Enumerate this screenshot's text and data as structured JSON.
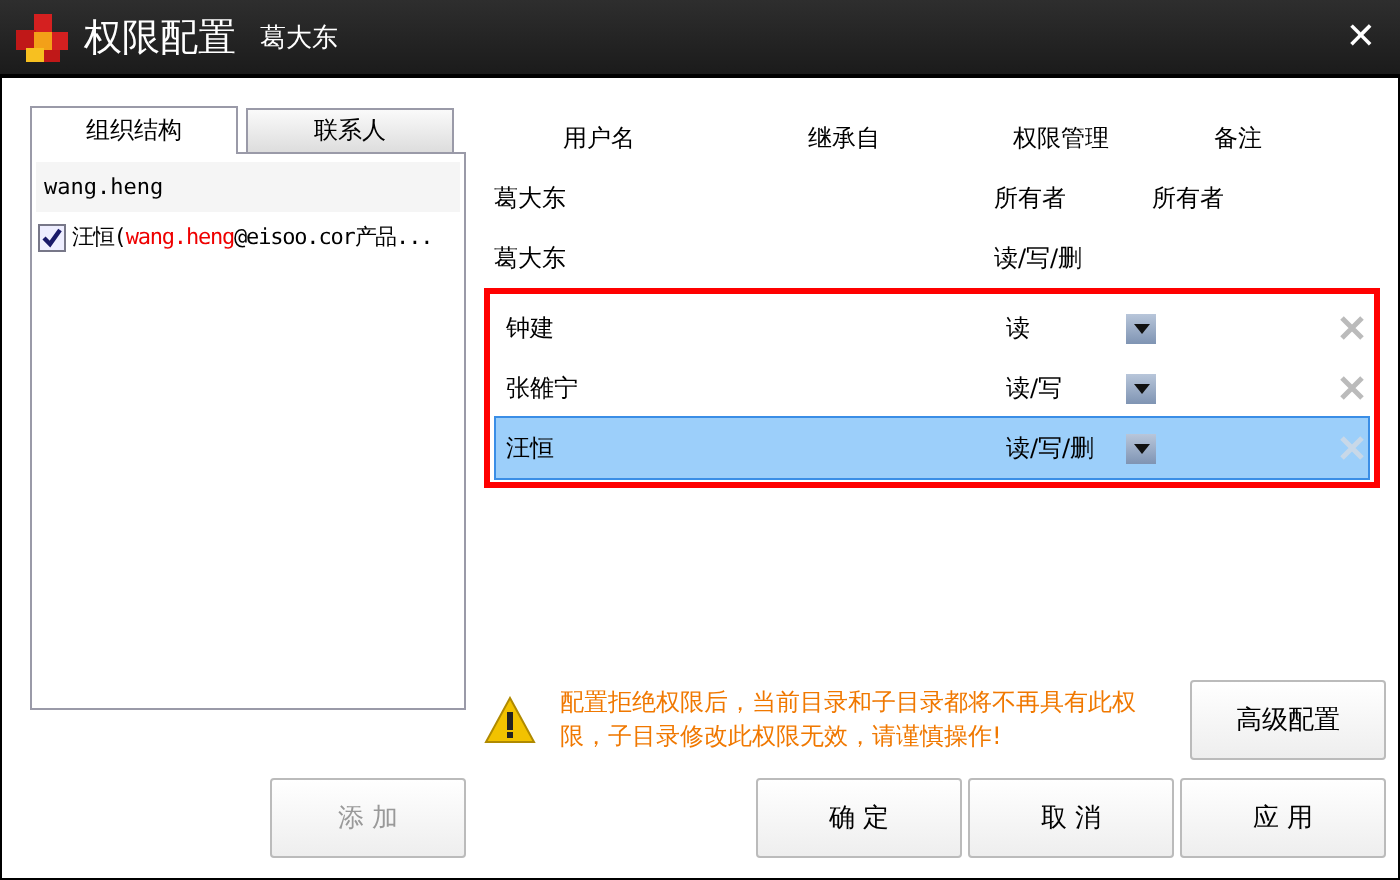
{
  "window": {
    "title": "权限配置",
    "subtitle": "葛大东",
    "close": "✕"
  },
  "tabs": [
    {
      "label": "组织结构",
      "selected": true
    },
    {
      "label": "联系人",
      "selected": false
    }
  ],
  "search": {
    "value": "wang.heng"
  },
  "results": [
    {
      "checked": true,
      "parts": [
        {
          "text": "汪恒(",
          "highlight": false
        },
        {
          "text": "wang.heng",
          "highlight": true
        },
        {
          "text": "@eisoo.cor产品...",
          "highlight": false
        }
      ]
    }
  ],
  "add_button": {
    "label": "添 加",
    "disabled": true
  },
  "table": {
    "columns": [
      "用户名",
      "继承自",
      "权限管理",
      "备注"
    ],
    "rows": [
      {
        "kind": "fixed",
        "name": "葛大东",
        "permission": "所有者",
        "note": "所有者",
        "selected": false
      },
      {
        "kind": "fixed",
        "name": "葛大东",
        "permission": "读/写/删",
        "selected": false
      }
    ],
    "marked_rows": [
      {
        "kind": "editable",
        "name": "钟建",
        "permission": "读",
        "selected": false
      },
      {
        "kind": "editable",
        "name": "张雒宁",
        "permission": "读/写",
        "selected": false
      },
      {
        "kind": "editable",
        "name": "汪恒",
        "permission": "读/写/删",
        "selected": true
      }
    ]
  },
  "warning": "配置拒绝权限后，当前目录和子目录都将不再具有此权限，子目录修改此权限无效，请谨慎操作!",
  "advanced_button": "高级配置",
  "buttons": [
    "确 定",
    "取 消",
    "应 用"
  ]
}
